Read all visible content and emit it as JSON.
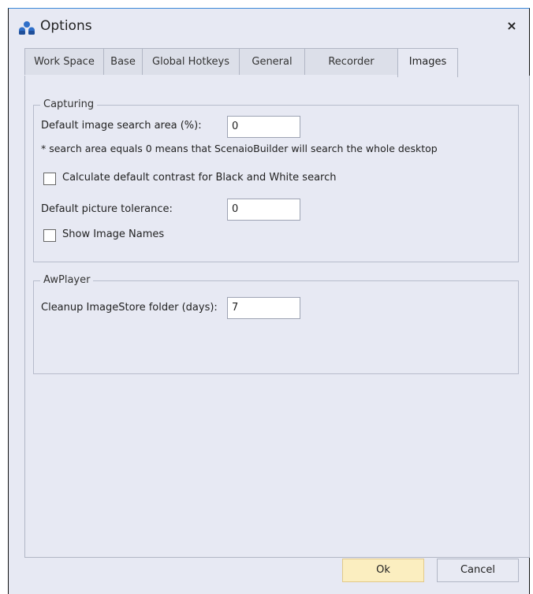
{
  "window": {
    "title": "Options",
    "close_glyph": "×",
    "icon": "app-people-icon"
  },
  "tabs": [
    {
      "label": "Work Space",
      "active": false
    },
    {
      "label": "Base",
      "active": false
    },
    {
      "label": "Global Hotkeys",
      "active": false
    },
    {
      "label": "General",
      "active": false
    },
    {
      "label": "Recorder",
      "active": false
    },
    {
      "label": "Images",
      "active": true
    }
  ],
  "capturing": {
    "title": "Capturing",
    "search_area_label": "Default image search area (%):",
    "search_area_value": "0",
    "note": "* search area equals 0 means that ScenaioBuilder will search the whole desktop",
    "contrast_label": "Calculate default contrast for Black and White search",
    "contrast_checked": false,
    "tolerance_label": "Default picture tolerance:",
    "tolerance_value": "0",
    "show_names_label": "Show Image Names",
    "show_names_checked": false
  },
  "awplayer": {
    "title": "AwPlayer",
    "cleanup_label": "Cleanup ImageStore folder (days):",
    "cleanup_value": "7"
  },
  "buttons": {
    "ok": "Ok",
    "cancel": "Cancel"
  },
  "colors": {
    "accent": "#3b87d8",
    "dialog_bg": "#e7e9f3",
    "ok_button": "#fbeec0"
  }
}
